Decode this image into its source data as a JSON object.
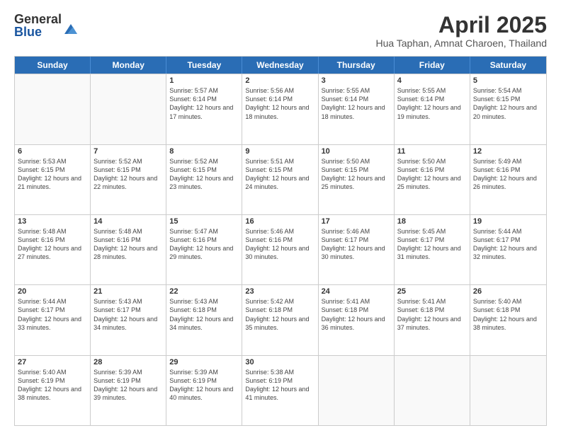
{
  "logo": {
    "general": "General",
    "blue": "Blue"
  },
  "title": {
    "month": "April 2025",
    "location": "Hua Taphan, Amnat Charoen, Thailand"
  },
  "calendar": {
    "headers": [
      "Sunday",
      "Monday",
      "Tuesday",
      "Wednesday",
      "Thursday",
      "Friday",
      "Saturday"
    ],
    "rows": [
      [
        {
          "day": "",
          "info": ""
        },
        {
          "day": "",
          "info": ""
        },
        {
          "day": "1",
          "info": "Sunrise: 5:57 AM\nSunset: 6:14 PM\nDaylight: 12 hours and 17 minutes."
        },
        {
          "day": "2",
          "info": "Sunrise: 5:56 AM\nSunset: 6:14 PM\nDaylight: 12 hours and 18 minutes."
        },
        {
          "day": "3",
          "info": "Sunrise: 5:55 AM\nSunset: 6:14 PM\nDaylight: 12 hours and 18 minutes."
        },
        {
          "day": "4",
          "info": "Sunrise: 5:55 AM\nSunset: 6:14 PM\nDaylight: 12 hours and 19 minutes."
        },
        {
          "day": "5",
          "info": "Sunrise: 5:54 AM\nSunset: 6:15 PM\nDaylight: 12 hours and 20 minutes."
        }
      ],
      [
        {
          "day": "6",
          "info": "Sunrise: 5:53 AM\nSunset: 6:15 PM\nDaylight: 12 hours and 21 minutes."
        },
        {
          "day": "7",
          "info": "Sunrise: 5:52 AM\nSunset: 6:15 PM\nDaylight: 12 hours and 22 minutes."
        },
        {
          "day": "8",
          "info": "Sunrise: 5:52 AM\nSunset: 6:15 PM\nDaylight: 12 hours and 23 minutes."
        },
        {
          "day": "9",
          "info": "Sunrise: 5:51 AM\nSunset: 6:15 PM\nDaylight: 12 hours and 24 minutes."
        },
        {
          "day": "10",
          "info": "Sunrise: 5:50 AM\nSunset: 6:15 PM\nDaylight: 12 hours and 25 minutes."
        },
        {
          "day": "11",
          "info": "Sunrise: 5:50 AM\nSunset: 6:16 PM\nDaylight: 12 hours and 25 minutes."
        },
        {
          "day": "12",
          "info": "Sunrise: 5:49 AM\nSunset: 6:16 PM\nDaylight: 12 hours and 26 minutes."
        }
      ],
      [
        {
          "day": "13",
          "info": "Sunrise: 5:48 AM\nSunset: 6:16 PM\nDaylight: 12 hours and 27 minutes."
        },
        {
          "day": "14",
          "info": "Sunrise: 5:48 AM\nSunset: 6:16 PM\nDaylight: 12 hours and 28 minutes."
        },
        {
          "day": "15",
          "info": "Sunrise: 5:47 AM\nSunset: 6:16 PM\nDaylight: 12 hours and 29 minutes."
        },
        {
          "day": "16",
          "info": "Sunrise: 5:46 AM\nSunset: 6:16 PM\nDaylight: 12 hours and 30 minutes."
        },
        {
          "day": "17",
          "info": "Sunrise: 5:46 AM\nSunset: 6:17 PM\nDaylight: 12 hours and 30 minutes."
        },
        {
          "day": "18",
          "info": "Sunrise: 5:45 AM\nSunset: 6:17 PM\nDaylight: 12 hours and 31 minutes."
        },
        {
          "day": "19",
          "info": "Sunrise: 5:44 AM\nSunset: 6:17 PM\nDaylight: 12 hours and 32 minutes."
        }
      ],
      [
        {
          "day": "20",
          "info": "Sunrise: 5:44 AM\nSunset: 6:17 PM\nDaylight: 12 hours and 33 minutes."
        },
        {
          "day": "21",
          "info": "Sunrise: 5:43 AM\nSunset: 6:17 PM\nDaylight: 12 hours and 34 minutes."
        },
        {
          "day": "22",
          "info": "Sunrise: 5:43 AM\nSunset: 6:18 PM\nDaylight: 12 hours and 34 minutes."
        },
        {
          "day": "23",
          "info": "Sunrise: 5:42 AM\nSunset: 6:18 PM\nDaylight: 12 hours and 35 minutes."
        },
        {
          "day": "24",
          "info": "Sunrise: 5:41 AM\nSunset: 6:18 PM\nDaylight: 12 hours and 36 minutes."
        },
        {
          "day": "25",
          "info": "Sunrise: 5:41 AM\nSunset: 6:18 PM\nDaylight: 12 hours and 37 minutes."
        },
        {
          "day": "26",
          "info": "Sunrise: 5:40 AM\nSunset: 6:18 PM\nDaylight: 12 hours and 38 minutes."
        }
      ],
      [
        {
          "day": "27",
          "info": "Sunrise: 5:40 AM\nSunset: 6:19 PM\nDaylight: 12 hours and 38 minutes."
        },
        {
          "day": "28",
          "info": "Sunrise: 5:39 AM\nSunset: 6:19 PM\nDaylight: 12 hours and 39 minutes."
        },
        {
          "day": "29",
          "info": "Sunrise: 5:39 AM\nSunset: 6:19 PM\nDaylight: 12 hours and 40 minutes."
        },
        {
          "day": "30",
          "info": "Sunrise: 5:38 AM\nSunset: 6:19 PM\nDaylight: 12 hours and 41 minutes."
        },
        {
          "day": "",
          "info": ""
        },
        {
          "day": "",
          "info": ""
        },
        {
          "day": "",
          "info": ""
        }
      ]
    ]
  }
}
